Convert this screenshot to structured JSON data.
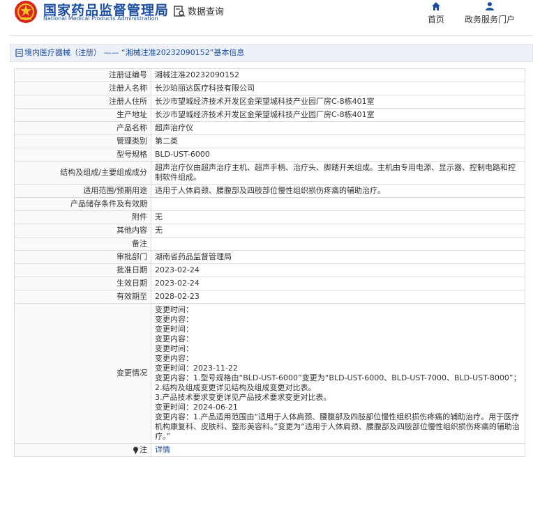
{
  "header": {
    "site_name_cn": "国家药品监督管理局",
    "site_name_en": "National Medical Products Administration",
    "query_label": "数据查询",
    "nav": [
      {
        "label": "首页",
        "icon": "home-icon"
      },
      {
        "label": "政务服务门户",
        "icon": "user-icon"
      }
    ],
    "brand_color": "#1b4ea3"
  },
  "titlebar": {
    "category": "境内医疗器械（注册）",
    "separator": "——",
    "subject": "“湘械注准20232090152”基本信息"
  },
  "fields": [
    {
      "key": "注册证编号",
      "value": "湘械注准20232090152"
    },
    {
      "key": "注册人名称",
      "value": "长沙珀丽达医疗科技有限公司"
    },
    {
      "key": "注册人住所",
      "value": "长沙市望城经济技术开发区金荣望城科技产业园厂房C-8栋401室"
    },
    {
      "key": "生产地址",
      "value": "长沙市望城经济技术开发区金荣望城科技产业园厂房C-8栋401室"
    },
    {
      "key": "产品名称",
      "value": "超声治疗仪"
    },
    {
      "key": "管理类别",
      "value": "第二类"
    },
    {
      "key": "型号规格",
      "value": "BLD-UST-6000"
    },
    {
      "key": "结构及组成/主要组成成分",
      "value": "超声治疗仪由超声治疗主机、超声手柄、治疗头、脚踏开关组成。主机由专用电源、显示器、控制电路和控制软件组成。"
    },
    {
      "key": "适用范围/预期用途",
      "value": "适用于人体肩颈、腰腹部及四肢部位慢性组织损伤疼痛的辅助治疗。"
    },
    {
      "key": "产品储存条件及有效期",
      "value": ""
    },
    {
      "key": "附件",
      "value": "无"
    },
    {
      "key": "其他内容",
      "value": "无"
    },
    {
      "key": "备注",
      "value": ""
    },
    {
      "key": "审批部门",
      "value": "湖南省药品监督管理局"
    },
    {
      "key": "批准日期",
      "value": "2023-02-24"
    },
    {
      "key": "生效日期",
      "value": "2023-02-24"
    },
    {
      "key": "有效期至",
      "value": "2028-02-23"
    }
  ],
  "change": {
    "key": "变更情况",
    "lines": [
      "变更时间：",
      "变更内容：",
      "变更时间：",
      "变更内容：",
      "变更时间：",
      "变更内容：",
      "变更时间：2023-11-22",
      "变更内容：1.型号规格由“BLD-UST-6000”变更为“BLD-UST-6000、BLD-UST-7000、BLD-UST-8000”；",
      "2.结构及组成变更详见结构及组成变更对比表。",
      "3.产品技术要求变更详见产品技术要求变更对比表。",
      "变更时间：2024-06-21",
      "变更内容：1.产品适用范围由“适用于人体肩颈、腰腹部及四肢部位慢性组织损伤疼痛的辅助治疗。用于医疗机构康复科、皮肤科、整形美容科。”变更为“适用于人体肩颈、腰腹部及四肢部位慢性组织损伤疼痛的辅助治疗。”"
    ]
  },
  "note": {
    "key": "注",
    "icon": "pin-icon",
    "link": "详情"
  }
}
